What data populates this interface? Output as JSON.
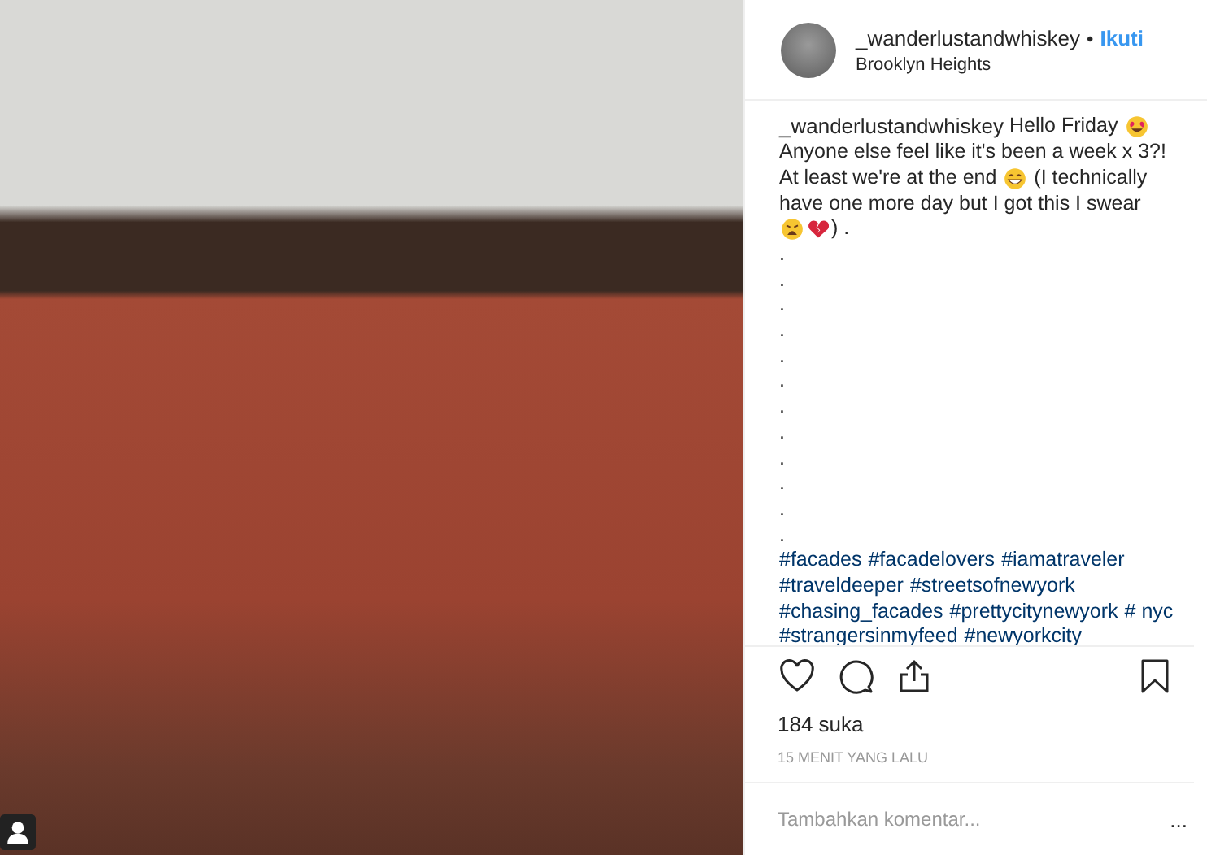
{
  "photo": {
    "tag_icon": true
  },
  "header": {
    "username": "_wanderlustandwhiskey",
    "separator": "•",
    "follow": "Ikuti",
    "location": "Brooklyn Heights"
  },
  "caption": {
    "lines": [
      {
        "segments": [
          {
            "kind": "username",
            "text": "_wanderlustandwhiskey"
          },
          {
            "kind": "text",
            "text": " Hello Friday "
          },
          {
            "kind": "heart-eyes"
          }
        ]
      },
      {
        "segments": [
          {
            "kind": "text",
            "text": "Anyone else feel like it's been a week x 3?!"
          }
        ]
      },
      {
        "segments": [
          {
            "kind": "text",
            "text": "At least we're at the end "
          },
          {
            "kind": "grin"
          },
          {
            "kind": "text",
            "text": " (I technically"
          }
        ]
      },
      {
        "segments": [
          {
            "kind": "text",
            "text": "have one more day but I got this I swear"
          }
        ]
      },
      {
        "segments": [
          {
            "kind": "weary"
          },
          {
            "kind": "broken-heart"
          },
          {
            "kind": "text",
            "text": ") ."
          }
        ]
      },
      {
        "segments": [
          {
            "kind": "text",
            "text": "."
          }
        ]
      },
      {
        "segments": [
          {
            "kind": "text",
            "text": "."
          }
        ]
      },
      {
        "segments": [
          {
            "kind": "text",
            "text": "."
          }
        ]
      },
      {
        "segments": [
          {
            "kind": "text",
            "text": "."
          }
        ]
      },
      {
        "segments": [
          {
            "kind": "text",
            "text": "."
          }
        ]
      },
      {
        "segments": [
          {
            "kind": "text",
            "text": "."
          }
        ]
      },
      {
        "segments": [
          {
            "kind": "text",
            "text": "."
          }
        ]
      },
      {
        "segments": [
          {
            "kind": "text",
            "text": "."
          }
        ]
      },
      {
        "segments": [
          {
            "kind": "text",
            "text": "."
          }
        ]
      },
      {
        "segments": [
          {
            "kind": "text",
            "text": "."
          }
        ]
      },
      {
        "segments": [
          {
            "kind": "text",
            "text": "."
          }
        ]
      },
      {
        "segments": [
          {
            "kind": "text",
            "text": "."
          }
        ]
      },
      {
        "segments": [
          {
            "kind": "hashtag",
            "text": "#facades"
          },
          {
            "kind": "hashtag",
            "text": "#facadelovers"
          },
          {
            "kind": "hashtag",
            "text": "#iamatraveler"
          }
        ]
      },
      {
        "segments": [
          {
            "kind": "hashtag",
            "text": "#traveldeeper"
          },
          {
            "kind": "hashtag",
            "text": "#streetsofnewyork"
          }
        ]
      },
      {
        "segments": [
          {
            "kind": "hashtag",
            "text": "#chasing_facades"
          },
          {
            "kind": "hashtag",
            "text": "#prettycitynewyork"
          },
          {
            "kind": "hashtag",
            "text": "# nyc"
          }
        ]
      },
      {
        "segments": [
          {
            "kind": "hashtag",
            "text": "#strangersinmyfeed"
          },
          {
            "kind": "hashtag",
            "text": "#newyorkcity"
          }
        ]
      }
    ]
  },
  "actions": [
    {
      "kind": "like"
    },
    {
      "kind": "comment"
    },
    {
      "kind": "share"
    },
    {
      "kind": "save"
    }
  ],
  "likes": "184 suka",
  "time": "15 MENIT YANG LALU",
  "comment": {
    "placeholder": "Tambahkan komentar...",
    "more": "..."
  }
}
